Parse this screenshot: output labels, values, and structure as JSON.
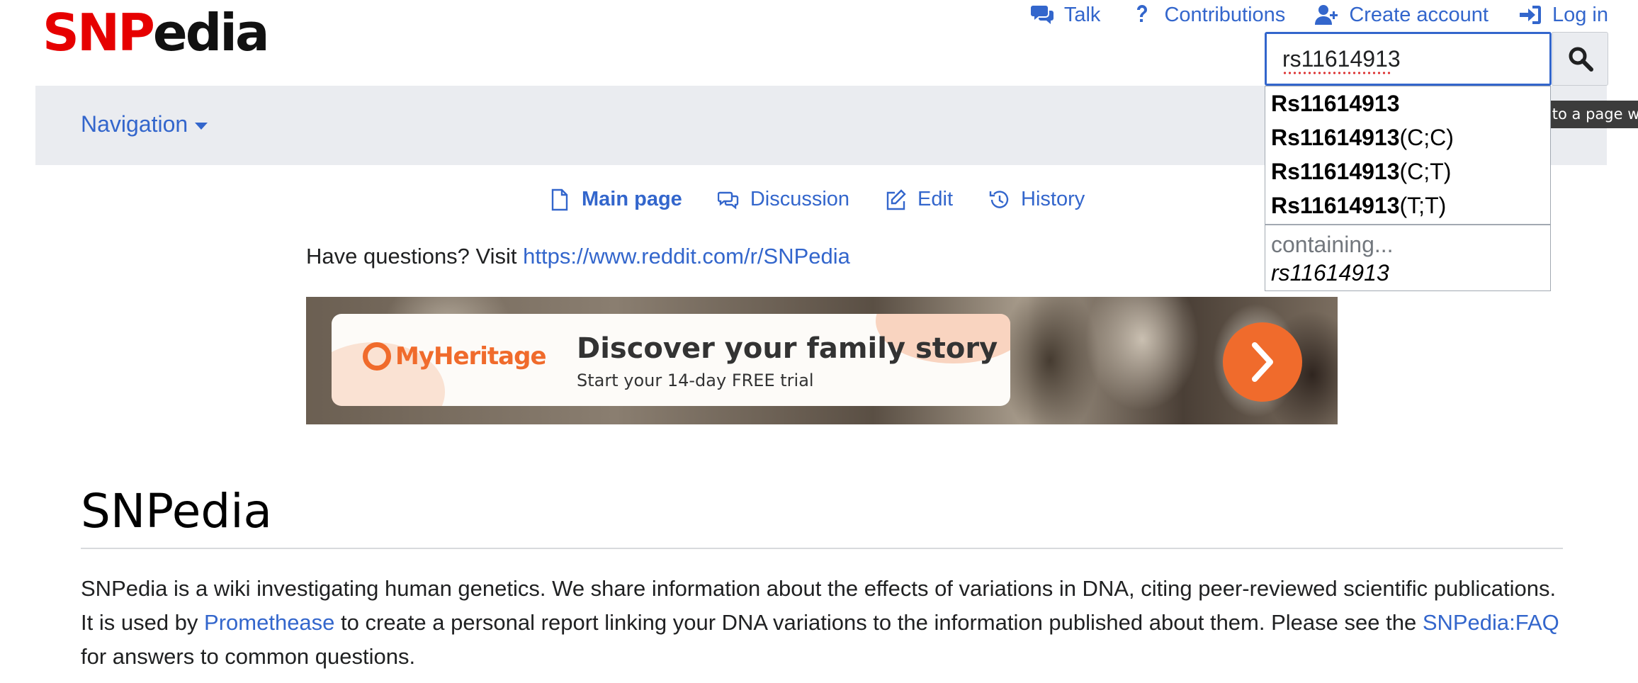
{
  "logo": {
    "part1": "SNP",
    "part2": "edia"
  },
  "personal": {
    "talk": "Talk",
    "contributions": "Contributions",
    "create_account": "Create account",
    "login": "Log in"
  },
  "search": {
    "value": "rs11614913",
    "button_icon": "search-icon",
    "tooltip": "Go to a page w"
  },
  "suggestions": {
    "items": [
      {
        "bold": "Rs11614913",
        "rest": ""
      },
      {
        "bold": "Rs11614913",
        "rest": "(C;C)"
      },
      {
        "bold": "Rs11614913",
        "rest": "(C;T)"
      },
      {
        "bold": "Rs11614913",
        "rest": "(T;T)"
      }
    ],
    "containing_label": "containing...",
    "containing_term": "rs11614913"
  },
  "nav": {
    "dropdown": "Navigation"
  },
  "tabs": {
    "main_page": "Main page",
    "discussion": "Discussion",
    "edit": "Edit",
    "history": "History"
  },
  "sitenotice": {
    "text": "Have questions? Visit ",
    "link": "https://www.reddit.com/r/SNPedia"
  },
  "banner": {
    "brand": "MyHeritage",
    "title": "Discover your family story",
    "subtitle": "Start your 14-day FREE trial"
  },
  "page": {
    "heading": "SNPedia",
    "p1": "SNPedia is a wiki investigating human genetics. We share information about the effects of variations in DNA, citing peer-reviewed scientific publications. It is used by ",
    "link_promethease": "Promethease",
    "p2": " to create a personal report linking your DNA variations to the information published about them. Please see the ",
    "link_faq": "SNPedia:FAQ",
    "p3": " for answers to common questions."
  },
  "colors": {
    "link": "#3366cc",
    "logo_red": "#e60000",
    "navbar": "#eaecf0",
    "banner_accent": "#f06b2c"
  }
}
